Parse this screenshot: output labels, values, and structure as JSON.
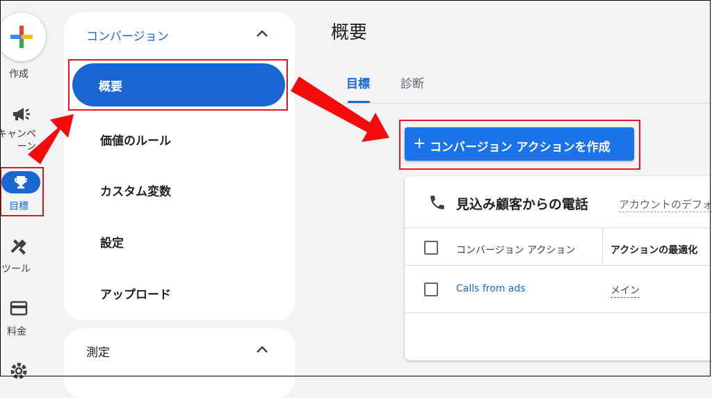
{
  "rail": {
    "create_label": "作成",
    "campaign_label": "キャンペーン",
    "goals_label": "目標",
    "tools_label": "ツール",
    "billing_label": "料金"
  },
  "nav": {
    "conversion_header": "コンバージョン",
    "items": [
      "概要",
      "価値のルール",
      "カスタム変数",
      "設定",
      "アップロード"
    ],
    "measurement_header": "測定"
  },
  "main": {
    "title": "概要",
    "tabs": [
      "目標",
      "診断"
    ],
    "create_button": "コンバージョン アクションを作成",
    "create_button_icon": "+",
    "card": {
      "title": "見込み顧客からの電話",
      "subtitle": "アカウントのデフォルト",
      "columns": [
        "コンバージョン アクション",
        "アクションの最適化"
      ],
      "rows": [
        {
          "name": "Calls from ads",
          "optimization": "メイン"
        }
      ]
    }
  },
  "colors": {
    "accent": "#1967d2",
    "highlight": "#e8131b",
    "arrow": "#f40c0c"
  },
  "icons": [
    "plus-icon",
    "megaphone-icon",
    "trophy-icon",
    "tools-icon",
    "credit-card-icon",
    "gear-icon",
    "chevron-up-icon",
    "phone-icon",
    "checkbox-icon"
  ]
}
